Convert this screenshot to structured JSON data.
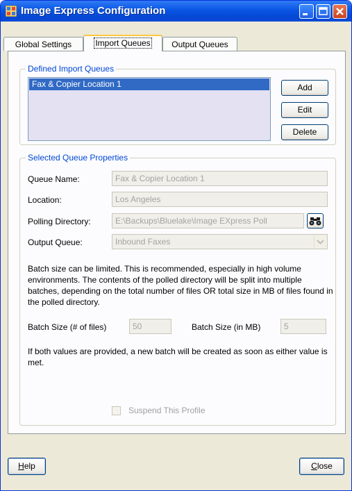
{
  "window": {
    "title": "Image Express Configuration"
  },
  "tabs": [
    {
      "label": "Global Settings"
    },
    {
      "label": "Import Queues"
    },
    {
      "label": "Output Queues"
    }
  ],
  "defined_queues": {
    "group_title": "Defined Import Queues",
    "items": [
      "Fax & Copier Location 1"
    ],
    "buttons": {
      "add": "Add",
      "edit": "Edit",
      "delete": "Delete"
    }
  },
  "properties": {
    "group_title": "Selected Queue Properties",
    "queue_name": {
      "label": "Queue Name:",
      "value": "Fax & Copier Location 1"
    },
    "location": {
      "label": "Location:",
      "value": "Los Angeles"
    },
    "polling_directory": {
      "label": "Polling Directory:",
      "value": "E:\\Backups\\Bluelake\\Image EXpress Poll"
    },
    "output_queue": {
      "label": "Output Queue:",
      "value": "Inbound Faxes"
    },
    "batch_note": "Batch size can be limited.  This is recommended, especially in high volume environments. The contents of the polled directory will be split into multiple batches, depending on the total number of files OR total size in MB of files found in the polled directory.",
    "batch_files": {
      "label": "Batch Size (# of files)",
      "value": "50"
    },
    "batch_mb": {
      "label": "Batch Size (in MB)",
      "value": "5"
    },
    "both_note": "If both values are provided, a new batch will be created as soon as either value is met.",
    "suspend_label": "Suspend This Profile",
    "suspend_checked": false
  },
  "footer": {
    "help": {
      "prefix": "H",
      "rest": "elp"
    },
    "close": {
      "prefix": "C",
      "rest": "lose"
    }
  },
  "colors": {
    "titlebar": "#0a56e4",
    "group_title": "#0046d5",
    "selection": "#316ac5"
  }
}
